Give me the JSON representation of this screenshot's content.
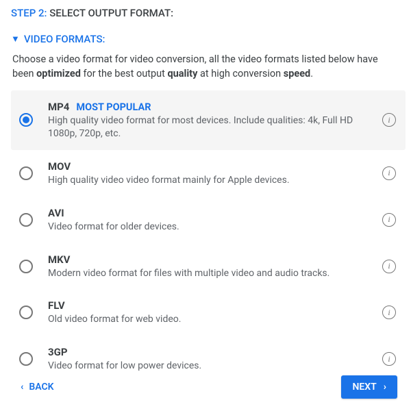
{
  "step": {
    "label": "STEP 2:",
    "title": "SELECT OUTPUT FORMAT:"
  },
  "section": {
    "title": "VIDEO FORMATS:",
    "desc_pre": "Choose a video format for video conversion, all the video formats listed below have been ",
    "desc_b1": "optimized",
    "desc_mid": " for the best output ",
    "desc_b2": "quality",
    "desc_post": " at high conversion ",
    "desc_b3": "speed",
    "desc_end": "."
  },
  "formats": [
    {
      "name": "MP4",
      "badge": "MOST POPULAR",
      "desc": "High quality video format for most devices. Include qualities: 4k, Full HD 1080p, 720p, etc.",
      "selected": true
    },
    {
      "name": "MOV",
      "badge": "",
      "desc": "High quality video video format mainly for Apple devices.",
      "selected": false
    },
    {
      "name": "AVI",
      "badge": "",
      "desc": "Video format for older devices.",
      "selected": false
    },
    {
      "name": "MKV",
      "badge": "",
      "desc": "Modern video format for files with multiple video and audio tracks.",
      "selected": false
    },
    {
      "name": "FLV",
      "badge": "",
      "desc": "Old video format for web video.",
      "selected": false
    },
    {
      "name": "3GP",
      "badge": "",
      "desc": "Video format for low power devices.",
      "selected": false
    }
  ],
  "footer": {
    "back": "BACK",
    "next": "NEXT"
  }
}
